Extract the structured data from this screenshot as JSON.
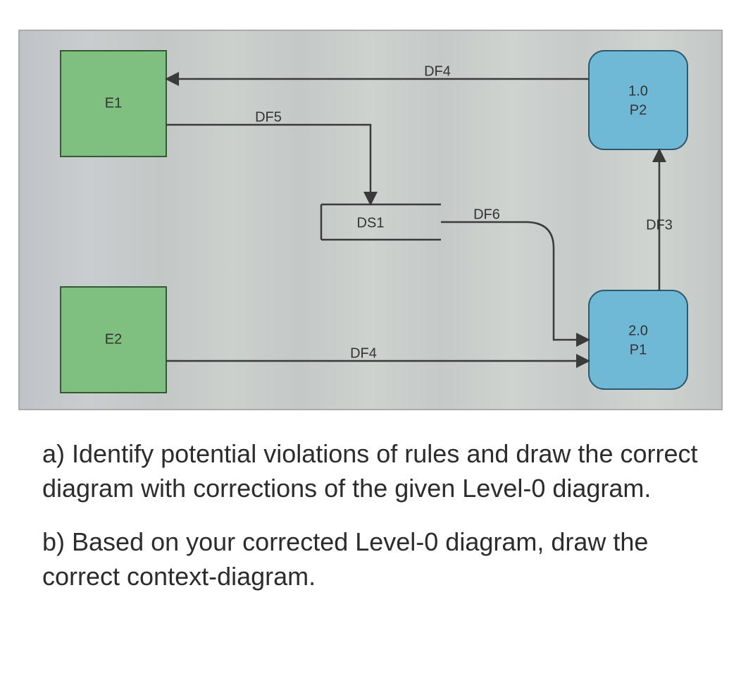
{
  "diagram": {
    "entities": {
      "e1": {
        "label": "E1"
      },
      "e2": {
        "label": "E2"
      }
    },
    "processes": {
      "p2": {
        "number": "1.0",
        "name": "P2"
      },
      "p1": {
        "number": "2.0",
        "name": "P1"
      }
    },
    "datastores": {
      "ds1": {
        "label": "DS1"
      }
    },
    "flows": {
      "df4_top": "DF4",
      "df5": "DF5",
      "df6": "DF6",
      "df3": "DF3",
      "df4_bottom": "DF4"
    }
  },
  "questions": {
    "a": "a) Identify potential violations of rules and draw the correct diagram with corrections of the given Level-0 diagram.",
    "b": "b) Based on your corrected Level-0 diagram, draw the correct context-diagram."
  }
}
